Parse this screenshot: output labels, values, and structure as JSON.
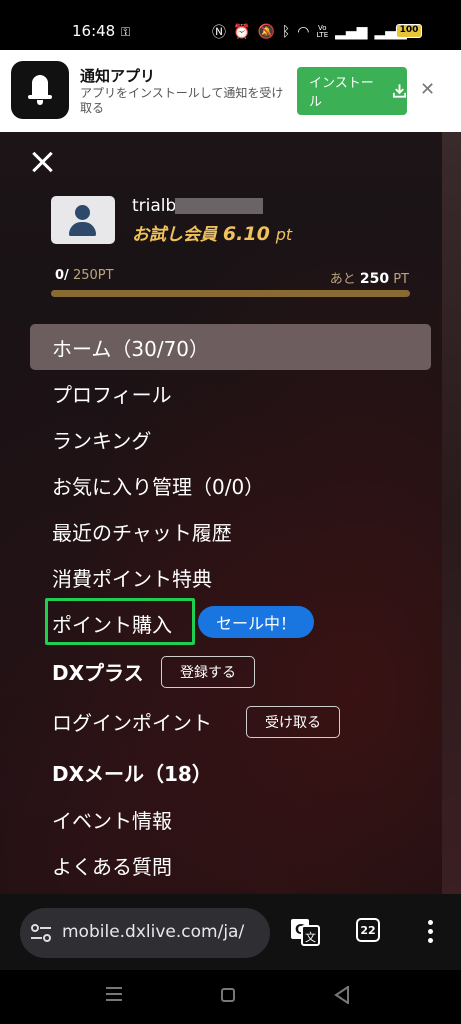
{
  "status": {
    "time": "16:48",
    "battery": "100",
    "network": "VoLTE"
  },
  "banner": {
    "title": "通知アプリ",
    "subtitle": "アプリをインストールして通知を受け取る",
    "install_label": "インストール",
    "close_glyph": "✕"
  },
  "profile": {
    "username": "trialb",
    "member_label": "お試し会員",
    "points": "6.10",
    "points_unit": "pt",
    "progress_current": "0/",
    "progress_goal": "250PT",
    "remaining_prefix": "あと",
    "remaining_value": "250",
    "remaining_unit": "PT",
    "progress_fraction": 0
  },
  "menu": {
    "home": "ホーム（30/70）",
    "profile": "プロフィール",
    "ranking": "ランキング",
    "favorites": "お気に入り管理（0/0）",
    "recent_chats": "最近のチャット履歴",
    "spending_bonus": "消費ポイント特典",
    "buy_points": "ポイント購入",
    "sale_badge": "セール中！",
    "dx_plus": "DXプラス",
    "register_button": "登録する",
    "login_points": "ログインポイント",
    "receive_button": "受け取る",
    "dx_mail": "DXメール（18）",
    "events": "イベント情報",
    "faq": "よくある質問"
  },
  "browser": {
    "url": "mobile.dxlive.com/ja/",
    "tab_count": "22"
  },
  "colors": {
    "accent_gold": "#f0c25a",
    "install_green": "#3cb054",
    "sale_blue": "#1976e0",
    "highlight_green": "#1fcf52"
  }
}
